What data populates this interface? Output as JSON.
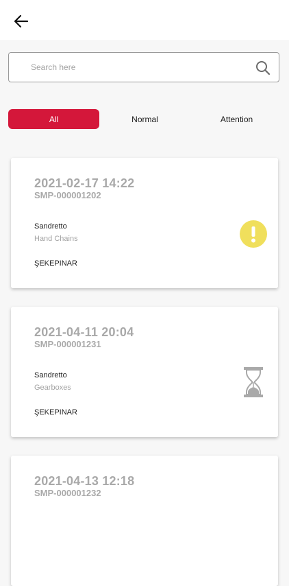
{
  "header": {
    "back_icon": "arrow-left-icon"
  },
  "search": {
    "placeholder": "Search here",
    "value": "",
    "icon": "search-icon"
  },
  "filters": {
    "tabs": [
      {
        "label": "All",
        "active": true
      },
      {
        "label": "Normal",
        "active": false
      },
      {
        "label": "Attention",
        "active": false
      }
    ],
    "active_color": "#d4173a"
  },
  "cards": [
    {
      "datetime": "2021-02-17 14:22",
      "code": "SMP-000001202",
      "company": "Sandretto",
      "category": "Hand Chains",
      "location": "ŞEKEPINAR",
      "status_icon": "exclamation-icon",
      "status_color": "#f0df5c"
    },
    {
      "datetime": "2021-04-11 20:04",
      "code": "SMP-000001231",
      "company": "Sandretto",
      "category": "Gearboxes",
      "location": "ŞEKEPINAR",
      "status_icon": "hourglass-icon",
      "status_color": "#a9a9a9"
    },
    {
      "datetime": "2021-04-13 12:18",
      "code": "SMP-000001232"
    }
  ]
}
